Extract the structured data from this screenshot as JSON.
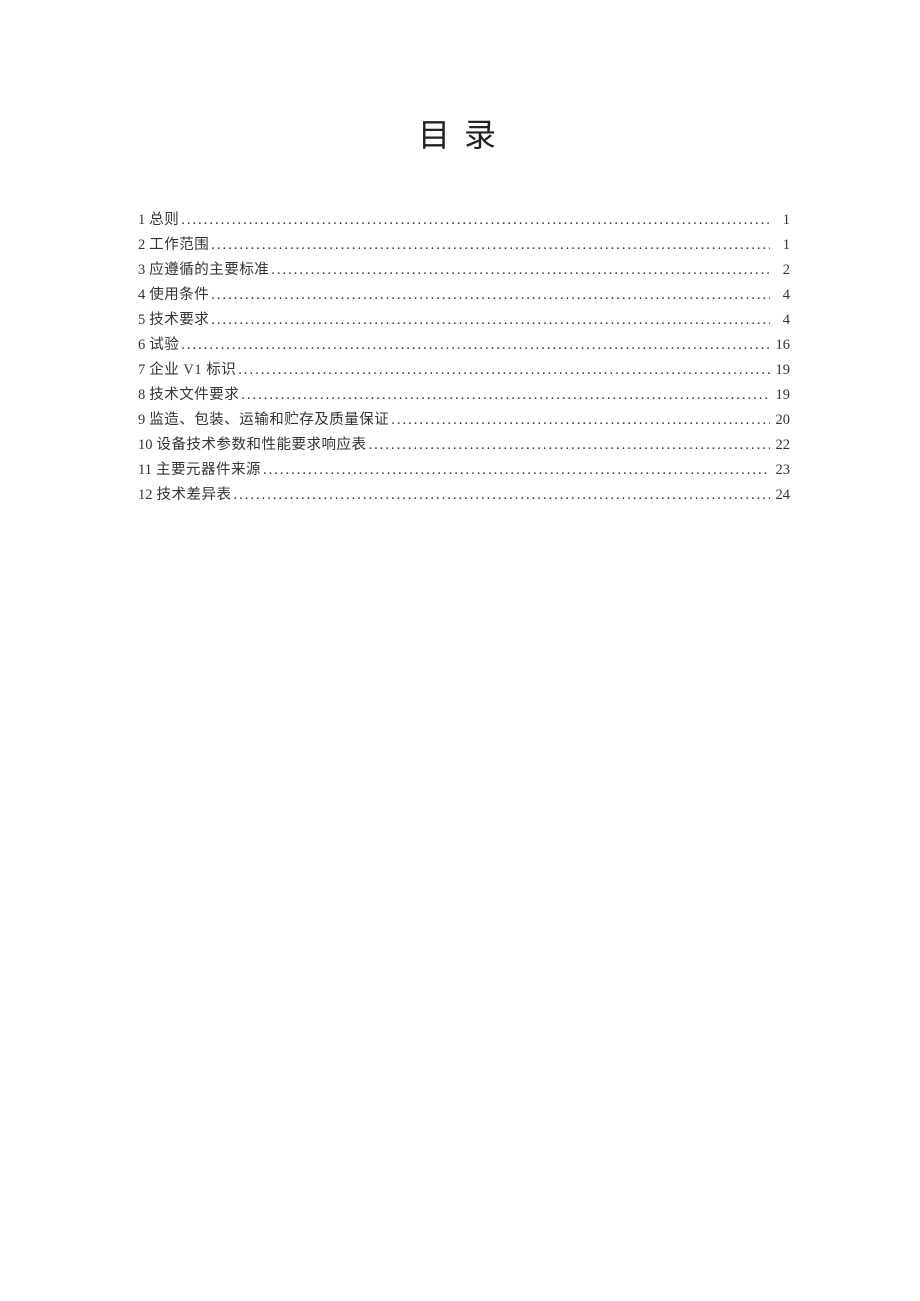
{
  "title": "目录",
  "toc": [
    {
      "num": "1",
      "text": "总则",
      "page": "1"
    },
    {
      "num": "2",
      "text": "工作范围",
      "page": "1"
    },
    {
      "num": "3",
      "text": "应遵循的主要标准",
      "page": "2"
    },
    {
      "num": "4",
      "text": "使用条件",
      "page": "4"
    },
    {
      "num": "5",
      "text": "技术要求",
      "page": "4"
    },
    {
      "num": "6",
      "text": "试验",
      "page": "16"
    },
    {
      "num": "7",
      "text": "企业 V1 标识",
      "page": "19"
    },
    {
      "num": "8",
      "text": "技术文件要求",
      "page": "19"
    },
    {
      "num": "9",
      "text": "监造、包装、运输和贮存及质量保证",
      "page": "20"
    },
    {
      "num": "10",
      "text": "设备技术参数和性能要求响应表",
      "page": "22"
    },
    {
      "num": "11",
      "text": "主要元器件来源",
      "page": "23"
    },
    {
      "num": "12",
      "text": "技术差异表",
      "page": "24"
    }
  ]
}
